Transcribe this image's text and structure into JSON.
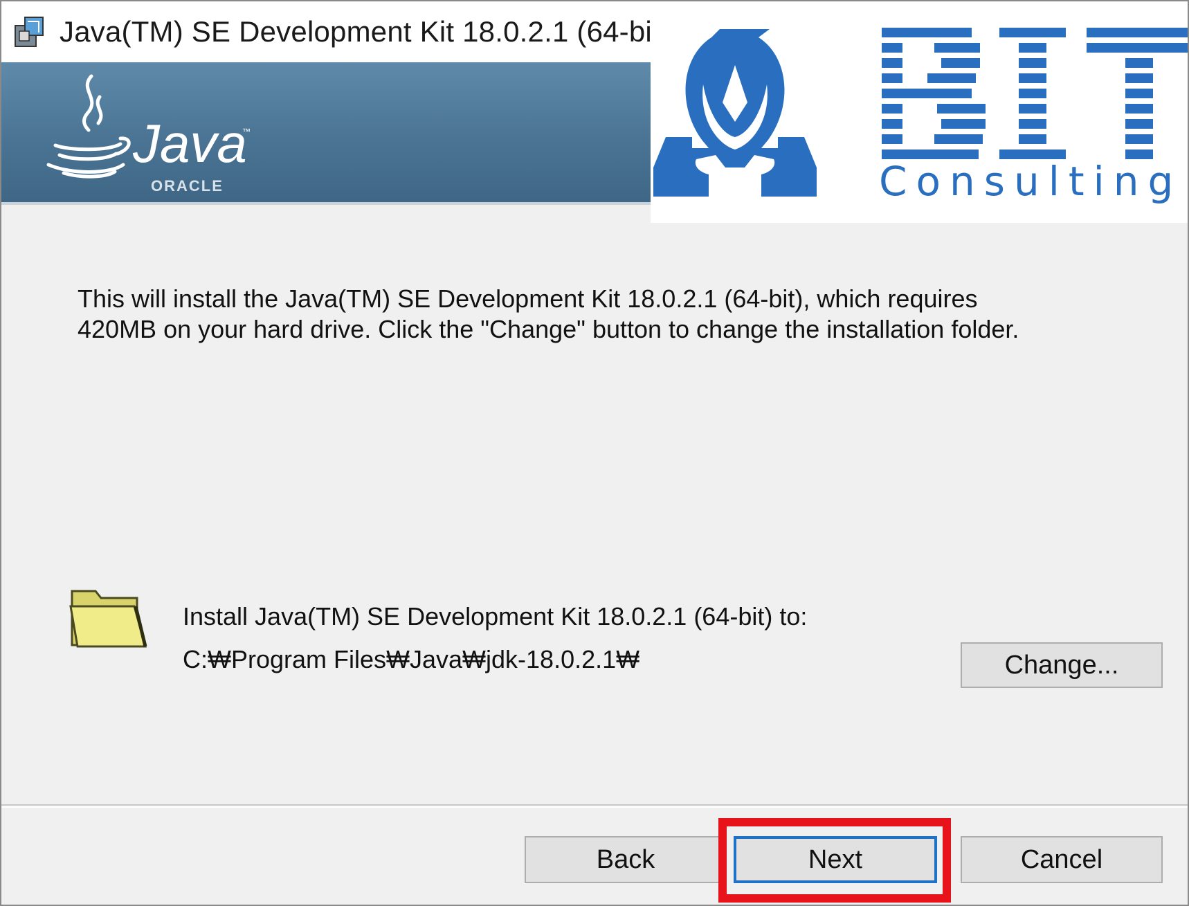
{
  "window": {
    "title": "Java(TM) SE Development Kit 18.0.2.1 (64-bit)"
  },
  "banner": {
    "java_wordmark": "Java",
    "oracle_wordmark": "ORACLE"
  },
  "overlay_logo": {
    "name": "BIT",
    "tagline": "Consulting",
    "color": "#2a6fbf"
  },
  "body": {
    "description": "This will install the Java(TM) SE Development Kit 18.0.2.1 (64-bit), which requires 420MB on your hard drive. Click the \"Change\" button to change the installation folder.",
    "install_label": "Install Java(TM) SE Development Kit 18.0.2.1 (64-bit) to:",
    "install_path": "C:₩Program Files₩Java₩jdk-18.0.2.1₩",
    "change_label": "Change..."
  },
  "footer": {
    "back_label": "Back",
    "next_label": "Next",
    "cancel_label": "Cancel",
    "highlight_color": "#e8121a"
  }
}
